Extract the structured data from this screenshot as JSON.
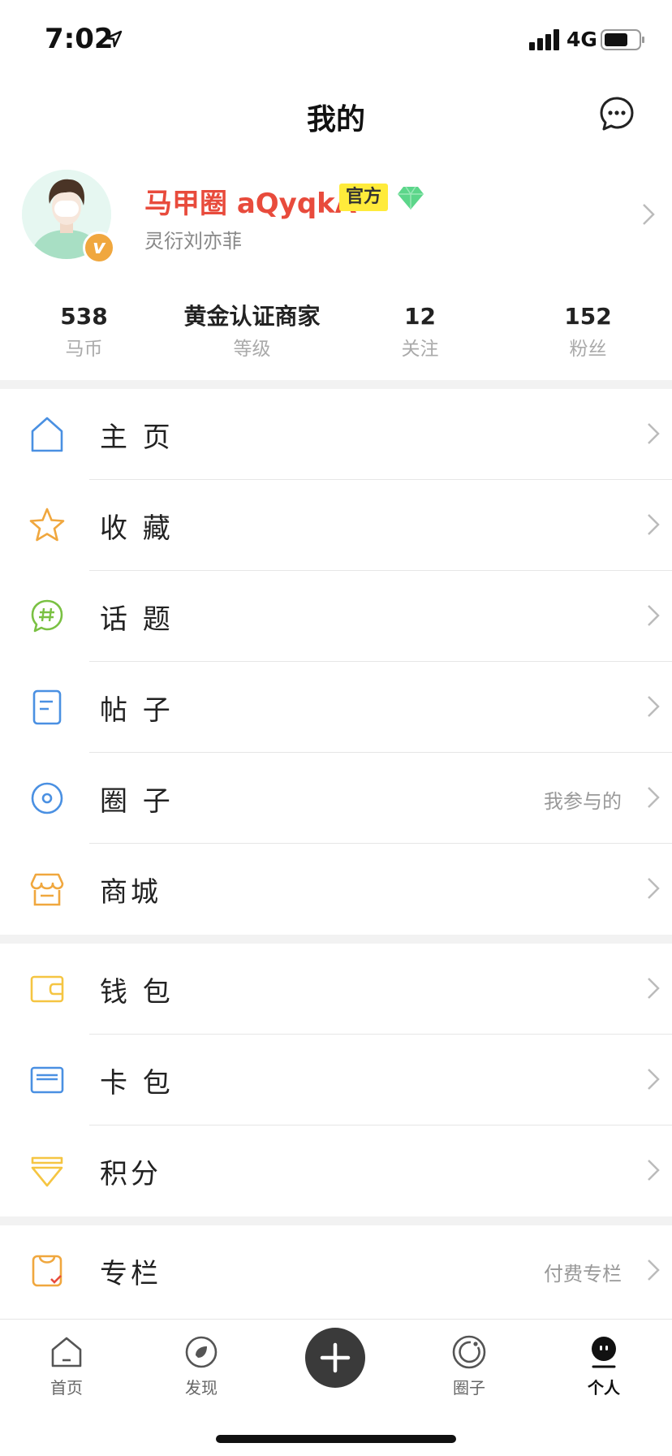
{
  "status_bar": {
    "time": "7:02",
    "network": "4G"
  },
  "nav": {
    "title": "我的"
  },
  "profile": {
    "username": "马甲圈 aQyqkA",
    "badge": "官方",
    "subtitle": "灵衍刘亦菲",
    "verified_mark": "v"
  },
  "stats": [
    {
      "value": "538",
      "label": "马币"
    },
    {
      "value": "黄金认证商家",
      "label": "等级"
    },
    {
      "value": "12",
      "label": "关注"
    },
    {
      "value": "152",
      "label": "粉丝"
    }
  ],
  "menu": {
    "home": {
      "label": "主 页"
    },
    "favorites": {
      "label": "收 藏"
    },
    "topics": {
      "label": "话 题"
    },
    "posts": {
      "label": "帖 子"
    },
    "circles": {
      "label": "圈 子",
      "hint": "我参与的"
    },
    "mall": {
      "label": "商城"
    },
    "wallet": {
      "label": "钱 包"
    },
    "cards": {
      "label": "卡 包"
    },
    "points": {
      "label": "积分"
    },
    "column": {
      "label": "专栏",
      "hint": "付费专栏"
    }
  },
  "tabs": [
    {
      "label": "首页"
    },
    {
      "label": "发现"
    },
    {
      "label": "圈子"
    },
    {
      "label": "个人"
    }
  ],
  "colors": {
    "username": "#e84b3c",
    "badge_bg": "#ffeb3b",
    "verified": "#f0a73e",
    "blue_icon": "#4a90e2",
    "orange_icon": "#f0a73e",
    "green_icon": "#7ac143",
    "yellow_icon": "#f5c542"
  }
}
